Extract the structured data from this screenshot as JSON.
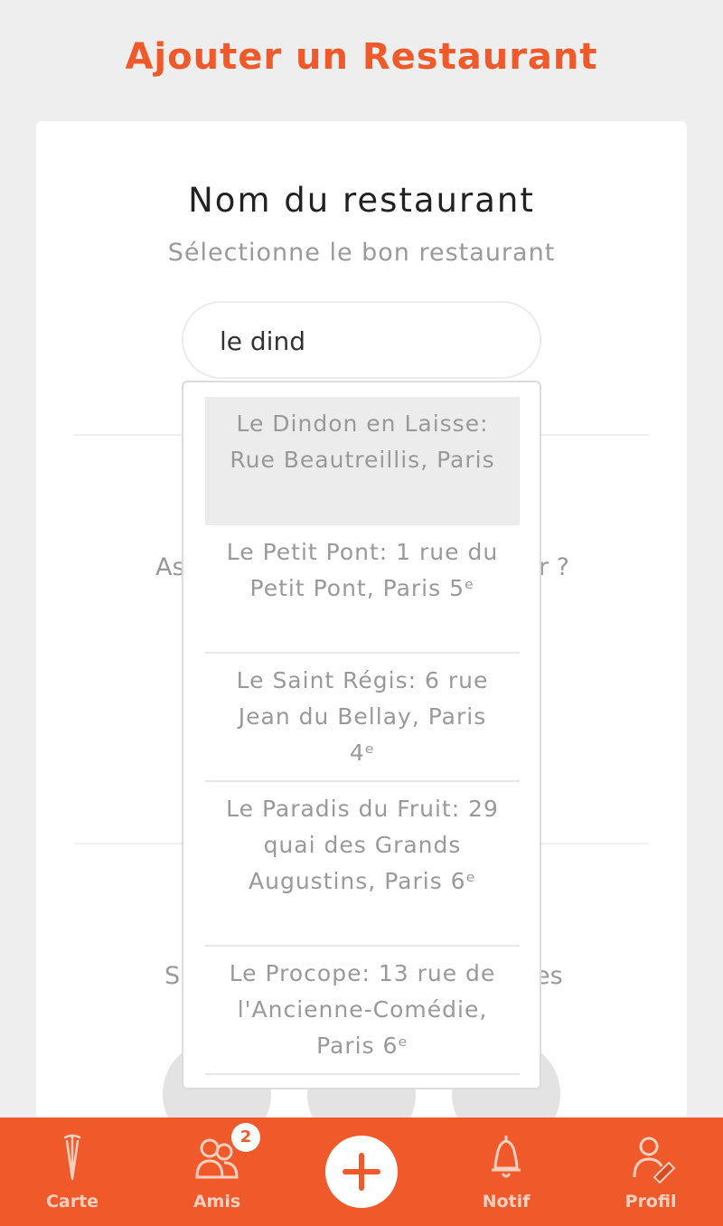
{
  "header": {
    "title": "Ajouter un Restaurant"
  },
  "form": {
    "section_title": "Nom du restaurant",
    "section_subtitle": "Sélectionne le bon restaurant",
    "search_value": "le dind",
    "behind": {
      "q1_left": "As",
      "q1_right": "r ?",
      "q2_left": "S",
      "q2_right": "es"
    }
  },
  "dropdown": {
    "items": [
      {
        "label": "Le Dindon en Laisse: Rue Beautreillis, Paris"
      },
      {
        "label": "Le Petit Pont: 1 rue du Petit Pont, Paris 5ᵉ"
      },
      {
        "label": "Le Saint Régis: 6 rue Jean du Bellay, Paris 4ᵉ"
      },
      {
        "label": "Le Paradis du Fruit: 29 quai des Grands Augustins, Paris 6ᵉ"
      },
      {
        "label": "Le Procope: 13 rue de l'Ancienne-Comédie, Paris 6ᵉ"
      }
    ]
  },
  "nav": {
    "carte": "Carte",
    "amis": "Amis",
    "amis_badge": "2",
    "notif": "Notif",
    "profil": "Profil",
    "add_icon": "plus-icon"
  },
  "colors": {
    "accent": "#f05a2b",
    "background": "#eeeeee"
  }
}
